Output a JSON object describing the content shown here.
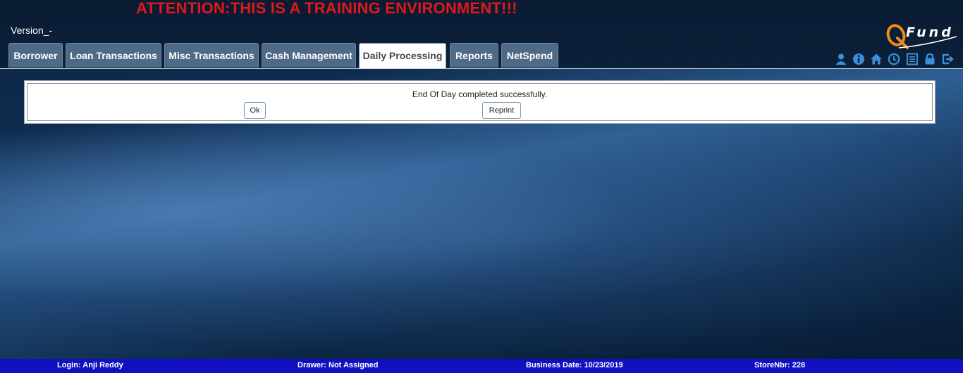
{
  "banner": {
    "attention": "ATTENTION:THIS IS A TRAINING ENVIRONMENT!!!"
  },
  "header": {
    "version": "Version_-",
    "logo_text": "Fund"
  },
  "tabs": [
    {
      "label": "Borrower"
    },
    {
      "label": "Loan Transactions"
    },
    {
      "label": "Misc Transactions"
    },
    {
      "label": "Cash Management"
    },
    {
      "label": "Daily Processing",
      "active": true
    },
    {
      "label": "Reports"
    },
    {
      "label": "NetSpend"
    }
  ],
  "toolbar_icons": [
    "user-icon",
    "info-icon",
    "home-icon",
    "clock-icon",
    "list-icon",
    "lock-icon",
    "logout-icon"
  ],
  "dialog": {
    "message": "End Of Day completed successfully.",
    "ok_label": "Ok",
    "reprint_label": "Reprint"
  },
  "footer": {
    "login": "Login: Anji Reddy",
    "drawer": "Drawer: Not Assigned",
    "business_date": "Business Date: 10/23/2019",
    "store": "StoreNbr: 228"
  },
  "colors": {
    "attention": "#e0181b",
    "tab_bg": "#4f6a86",
    "footer_bg": "#1010c0",
    "icon": "#3a8fd9",
    "logo_accent": "#f08a1c"
  }
}
